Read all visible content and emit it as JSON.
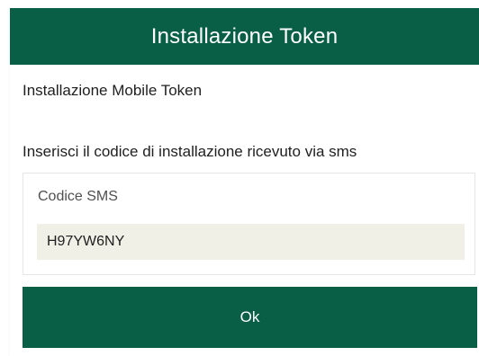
{
  "dialog": {
    "title": "Installazione Token",
    "subtitle": "Installazione Mobile Token",
    "instructions": "Inserisci il codice di installazione ricevuto via sms",
    "sms_field": {
      "label": "Codice SMS",
      "value": "H97YW6NY"
    },
    "ok_label": "Ok"
  },
  "colors": {
    "primary_green": "#085f45",
    "input_background": "#f1f0e7"
  }
}
